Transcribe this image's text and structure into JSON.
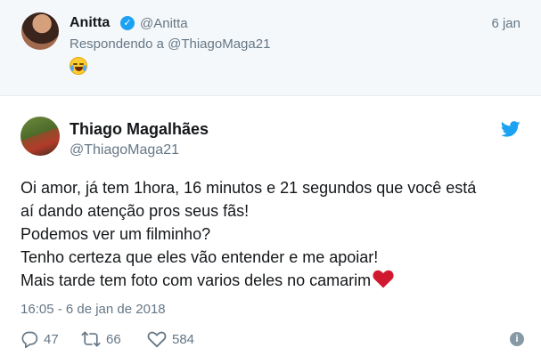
{
  "reply": {
    "name": "Anitta",
    "handle": "@Anitta",
    "date": "6 jan",
    "replying_prefix": "Respondendo a",
    "replying_to": "@ThiagoMaga21",
    "emoji": "crying-laughing-face"
  },
  "tweet": {
    "name": "Thiago Magalhães",
    "handle": "@ThiagoMaga21",
    "lines": [
      "Oi amor, já tem 1hora, 16 minutos e 21 segundos que você está",
      "aí dando atenção pros seus fãs!",
      "Podemos ver um filminho?",
      "Tenho certeza que eles vão entender e me apoiar!",
      "Mais tarde tem foto com varios deles no camarim"
    ],
    "timestamp": "16:05 - 6 de jan de 2018",
    "replies": "47",
    "retweets": "66",
    "likes": "584"
  },
  "colors": {
    "accent": "#1da1f2",
    "muted": "#657786",
    "heart": "#e0245e"
  }
}
